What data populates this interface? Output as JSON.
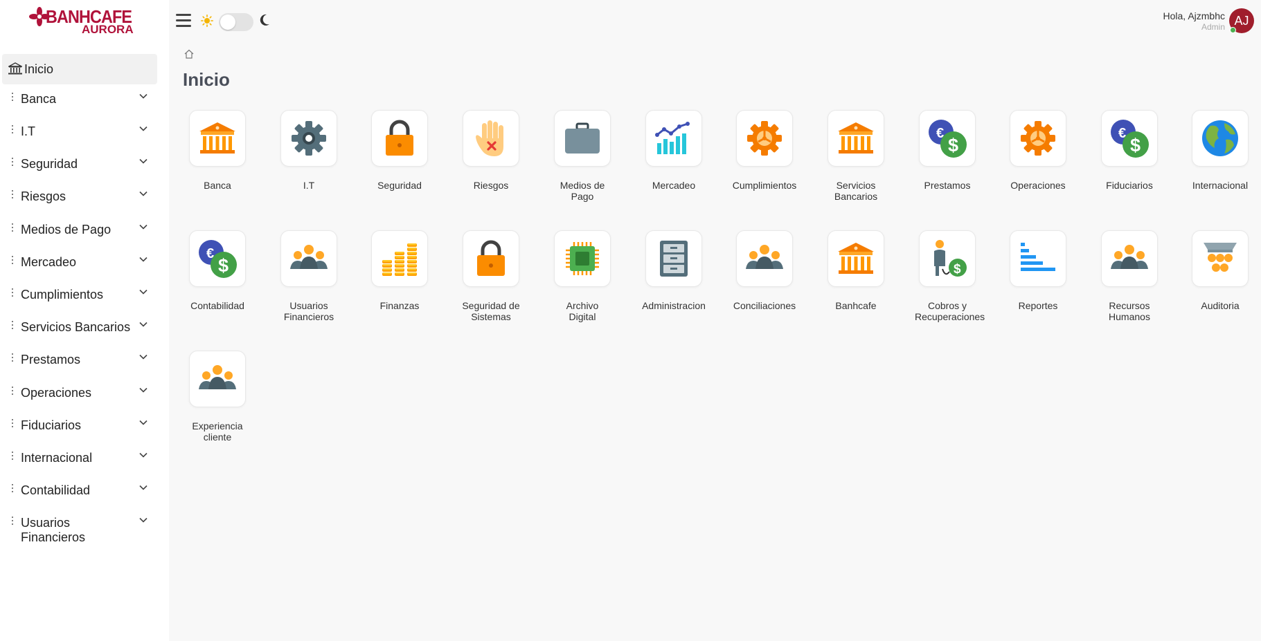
{
  "brand": {
    "name": "BANHCAFE",
    "sub": "AURORA",
    "color": "#b0123a"
  },
  "sidebar": {
    "home_label": "Inicio",
    "items": [
      {
        "label": "Banca"
      },
      {
        "label": "I.T"
      },
      {
        "label": "Seguridad"
      },
      {
        "label": "Riesgos"
      },
      {
        "label": "Medios de Pago"
      },
      {
        "label": "Mercadeo"
      },
      {
        "label": "Cumplimientos"
      },
      {
        "label": "Servicios Bancarios"
      },
      {
        "label": "Prestamos"
      },
      {
        "label": "Operaciones"
      },
      {
        "label": "Fiduciarios"
      },
      {
        "label": "Internacional"
      },
      {
        "label": "Contabilidad"
      },
      {
        "label": "Usuarios Financieros"
      }
    ]
  },
  "topbar": {
    "greeting": "Hola, Ajzmbhc",
    "role": "Admin",
    "avatar_initials": "AJ",
    "avatar_color": "#a01e2c"
  },
  "main": {
    "title": "Inicio",
    "modules": [
      {
        "label": "Banca",
        "icon": "bank-icon"
      },
      {
        "label": "I.T",
        "icon": "gear-icon"
      },
      {
        "label": "Seguridad",
        "icon": "lock-icon"
      },
      {
        "label": "Riesgos",
        "icon": "hand-stop-icon"
      },
      {
        "label": "Medios de Pago",
        "icon": "briefcase-icon"
      },
      {
        "label": "Mercadeo",
        "icon": "bar-chart-icon"
      },
      {
        "label": "Cumplimientos",
        "icon": "orange-gear-icon"
      },
      {
        "label": "Servicios Bancarios",
        "icon": "bank-icon"
      },
      {
        "label": "Prestamos",
        "icon": "currency-exchange-icon"
      },
      {
        "label": "Operaciones",
        "icon": "orange-gear-icon"
      },
      {
        "label": "Fiduciarios",
        "icon": "currency-exchange-icon"
      },
      {
        "label": "Internacional",
        "icon": "globe-icon"
      },
      {
        "label": "Contabilidad",
        "icon": "currency-exchange-icon"
      },
      {
        "label": "Usuarios Financieros",
        "icon": "people-group-icon"
      },
      {
        "label": "Finanzas",
        "icon": "coins-icon"
      },
      {
        "label": "Seguridad de Sistemas",
        "icon": "lock-icon"
      },
      {
        "label": "Archivo Digital",
        "icon": "chip-icon"
      },
      {
        "label": "Administracion",
        "icon": "filing-cabinet-icon"
      },
      {
        "label": "Conciliaciones",
        "icon": "people-group-icon"
      },
      {
        "label": "Banhcafe",
        "icon": "bank-icon"
      },
      {
        "label": "Cobros y Recuperaciones",
        "icon": "debt-collector-icon"
      },
      {
        "label": "Reportes",
        "icon": "bar-list-icon"
      },
      {
        "label": "Recursos Humanos",
        "icon": "people-group-icon"
      },
      {
        "label": "Auditoria",
        "icon": "org-tree-icon"
      },
      {
        "label": "Experiencia cliente",
        "icon": "people-group-icon"
      }
    ]
  }
}
